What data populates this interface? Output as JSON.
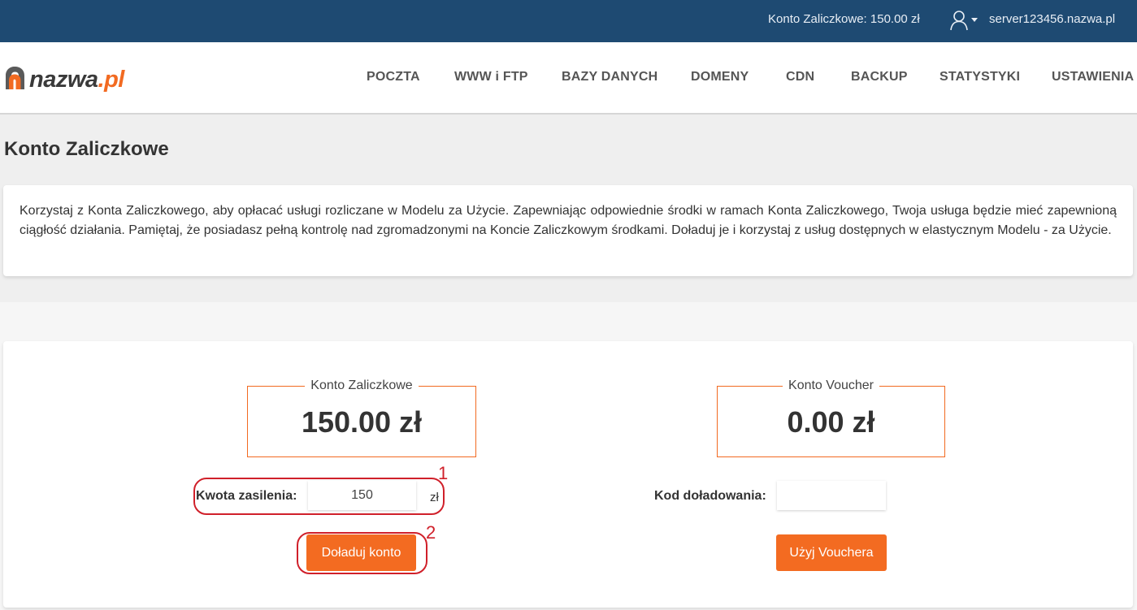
{
  "topbar": {
    "balance_text": "Konto Zaliczkowe: 150.00 zł",
    "user_icon": "user-icon",
    "server_name": "server123456.nazwa.pl",
    "bg_color": "#1e4a72"
  },
  "logo": {
    "brand_main": "nazwa",
    "brand_tld": ".pl",
    "accent_color": "#f26a21"
  },
  "nav": {
    "items": [
      {
        "label": "POCZTA"
      },
      {
        "label": "WWW i FTP"
      },
      {
        "label": "BAZY DANYCH"
      },
      {
        "label": "DOMENY"
      },
      {
        "label": "CDN"
      },
      {
        "label": "BACKUP"
      },
      {
        "label": "STATYSTYKI"
      },
      {
        "label": "USTAWIENIA"
      }
    ]
  },
  "page": {
    "title": "Konto Zaliczkowe",
    "info_text": "Korzystaj z Konta Zaliczkowego, aby opłacać usługi rozliczane w Modelu za Użycie. Zapewniając odpowiednie środki w ramach Konta Zaliczkowego, Twoja usługa będzie mieć zapewnioną ciągłość działania. Pamiętaj, że posiadasz pełną kontrolę nad zgromadzonymi na Koncie Zaliczkowym środkami. Doładuj je i korzystaj z usług dostępnych w elastycznym Modelu - za Użycie."
  },
  "advance_account": {
    "legend": "Konto Zaliczkowe",
    "amount": "150.00 zł",
    "topup_label": "Kwota zasilenia:",
    "topup_value": "150",
    "unit": "zł",
    "button_label": "Doładuj konto"
  },
  "voucher_account": {
    "legend": "Konto Voucher",
    "amount": "0.00 zł",
    "code_label": "Kod doładowania:",
    "code_value": "",
    "button_label": "Użyj Vouchera"
  },
  "annotations": {
    "marker_1": "1",
    "marker_2": "2",
    "color": "#d0202a"
  }
}
